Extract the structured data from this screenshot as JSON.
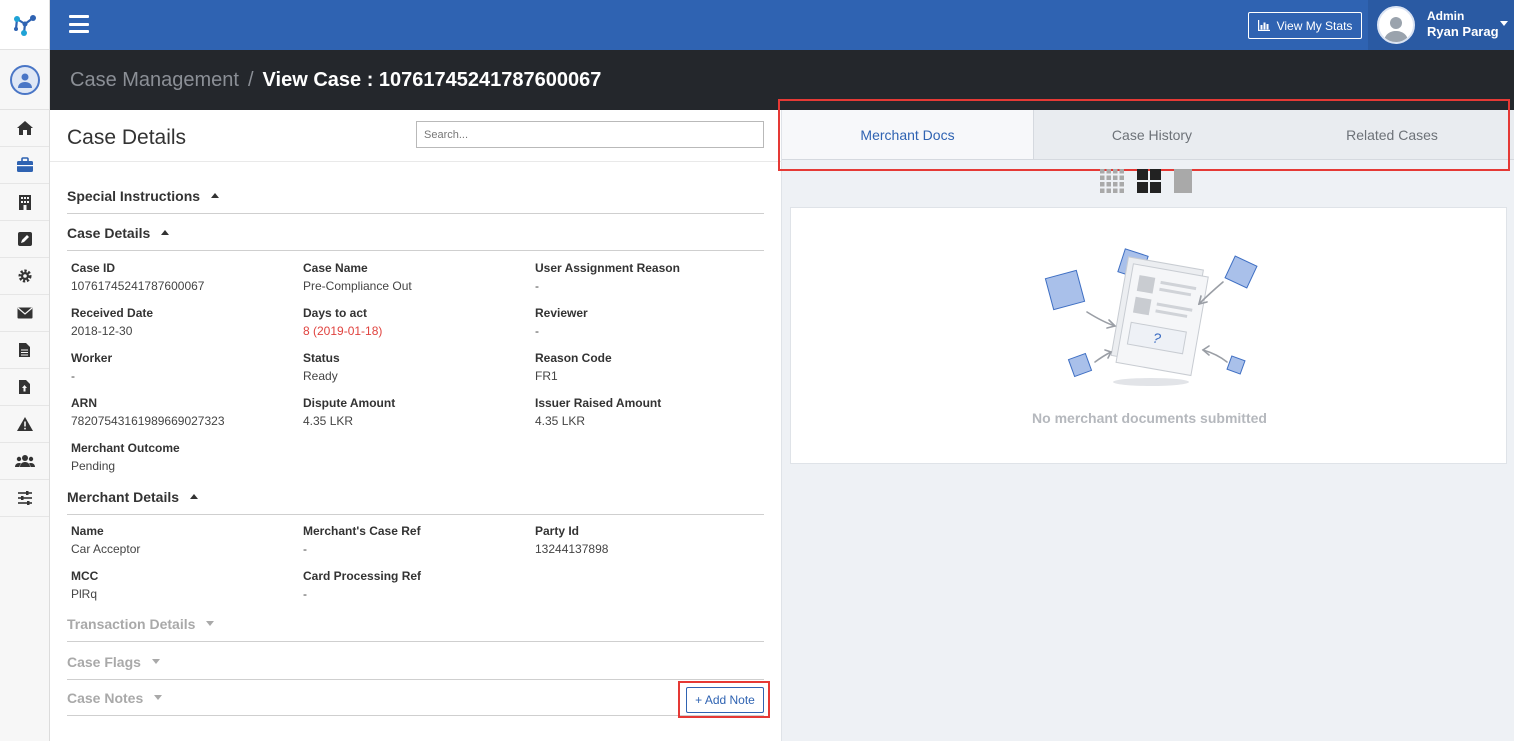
{
  "topbar": {
    "stats_button": "View My Stats"
  },
  "user": {
    "role": "Admin",
    "name": "Ryan Parag"
  },
  "breadcrumb": {
    "root": "Case Management",
    "separator": "/",
    "current": "View Case : 10761745241787600067"
  },
  "left_panel": {
    "title": "Case Details",
    "search_placeholder": "Search...",
    "sections": {
      "special_instructions": "Special Instructions",
      "case_details": "Case Details",
      "merchant_details": "Merchant Details",
      "transaction_details": "Transaction Details",
      "case_flags": "Case Flags",
      "case_notes": "Case Notes"
    },
    "case_fields": [
      {
        "label": "Case ID",
        "value": "10761745241787600067"
      },
      {
        "label": "Case Name",
        "value": "Pre-Compliance Out"
      },
      {
        "label": "User Assignment Reason",
        "value": "-"
      },
      {
        "label": "Received Date",
        "value": "2018-12-30"
      },
      {
        "label": "Days to act",
        "value": "8 (2019-01-18)"
      },
      {
        "label": "Reviewer",
        "value": "-"
      },
      {
        "label": "Worker",
        "value": "-"
      },
      {
        "label": "Status",
        "value": "Ready"
      },
      {
        "label": "Reason Code",
        "value": "FR1"
      },
      {
        "label": "ARN",
        "value": "78207543161989669027323"
      },
      {
        "label": "Dispute Amount",
        "value": "4.35 LKR"
      },
      {
        "label": "Issuer Raised Amount",
        "value": "4.35 LKR"
      },
      {
        "label": "Merchant Outcome",
        "value": "Pending"
      }
    ],
    "merchant_fields": [
      {
        "label": "Name",
        "value": "Car Acceptor"
      },
      {
        "label": "Merchant's Case Ref",
        "value": "-"
      },
      {
        "label": "Party Id",
        "value": "13244137898"
      },
      {
        "label": "MCC",
        "value": "PlRq"
      },
      {
        "label": "Card Processing Ref",
        "value": "-"
      }
    ],
    "add_note_button": "+ Add Note"
  },
  "right_panel": {
    "tabs": [
      {
        "label": "Merchant Docs",
        "active": true
      },
      {
        "label": "Case History",
        "active": false
      },
      {
        "label": "Related Cases",
        "active": false
      }
    ],
    "empty_message": "No merchant documents submitted",
    "view_modes": [
      "grid-small-icon",
      "grid-large-icon",
      "single-page-icon"
    ]
  },
  "colors": {
    "brand": "#2f63b2",
    "alert": "#e0433f",
    "highlight_box": "#e53935"
  }
}
